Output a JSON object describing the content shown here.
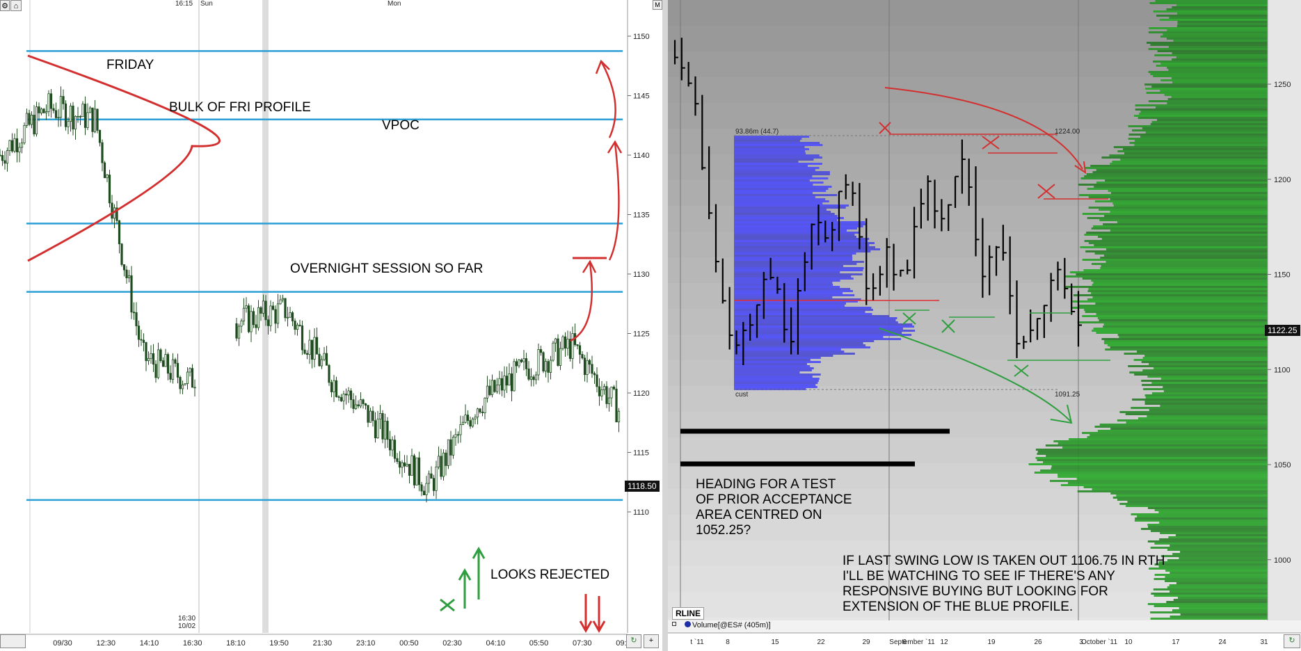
{
  "left_chart": {
    "session_labels": [
      "16:15",
      "Sun",
      "Mon"
    ],
    "session_break_label": [
      "16:30",
      "10/02"
    ],
    "price_ticks": [
      "1150",
      "1145",
      "1140",
      "1135",
      "1130",
      "1125",
      "1120",
      "1115",
      "1110"
    ],
    "time_ticks": [
      "09/30",
      "12:30",
      "14:10",
      "16:30",
      "18:10",
      "19:50",
      "21:30",
      "23:10",
      "00:50",
      "02:30",
      "04:10",
      "05:50",
      "07:30",
      "09:10"
    ],
    "last_price": "1118.50",
    "levels": [
      1148.75,
      1143.0,
      1134.25,
      1128.5,
      1111.0
    ],
    "annotations": {
      "friday": "FRIDAY",
      "bulk": "BULK OF FRI PROFILE",
      "vpoc": "VPOC",
      "overnight": "OVERNIGHT SESSION SO FAR",
      "rejected": "LOOKS REJECTED"
    }
  },
  "right_chart": {
    "price_ticks": [
      "1250",
      "1200",
      "1150",
      "1100",
      "1050",
      "1000"
    ],
    "date_ticks": [
      "t `11",
      "8",
      "15",
      "22",
      "29",
      "September `11",
      "6",
      "12",
      "19",
      "26",
      "October `11",
      "3",
      "10",
      "17",
      "24",
      "31"
    ],
    "last_price": "1122.25",
    "profile_labels": {
      "top_left": "93.86m (44.7)",
      "top_right": "1224.00",
      "bottom_left": "cust",
      "bottom_right": "1091.25"
    },
    "rline_label": "RLINE",
    "volume_label": "Volume[@ES# (405m)]",
    "notes": {
      "heading": "HEADING FOR A TEST\nOF PRIOR ACCEPTANCE\nAREA CENTRED ON\n1052.25?",
      "swing": "IF LAST SWING LOW IS TAKEN OUT 1106.75 IN RTH\nI'LL BE WATCHING TO SEE IF THERE'S ANY\nRESPONSIVE BUYING BUT LOOKING FOR\nEXTENSION OF THE BLUE PROFILE."
    }
  },
  "colors": {
    "level_line": "#2a9fd6",
    "bull_candle": "#2e7d32",
    "annotation_red": "#d32f2f",
    "annotation_green": "#2e9e3f",
    "profile_blue": "#5a5af0",
    "profile_green": "#2a9a2a"
  },
  "chart_data": [
    {
      "type": "candlestick",
      "title": "",
      "ylim": [
        1108,
        1153
      ],
      "x": [
        "09/30",
        "12:30",
        "14:10",
        "16:30",
        "18:10",
        "19:50",
        "21:30",
        "23:10",
        "00:50",
        "02:30",
        "04:10",
        "05:50",
        "07:30",
        "09:10"
      ],
      "series": [
        {
          "values": [
            1140,
            1144,
            1143,
            1123,
            1121,
            1126,
            1127,
            1121,
            1117,
            1112,
            1119,
            1122,
            1124,
            1118.5
          ]
        }
      ],
      "horizontal_levels": [
        1148.75,
        1143.0,
        1134.25,
        1128.5,
        1111.0
      ]
    },
    {
      "type": "bar",
      "title": "",
      "ylim": [
        975,
        1275
      ],
      "x": [
        "8",
        "15",
        "22",
        "29",
        "6",
        "12",
        "19",
        "26",
        "3"
      ],
      "series": [
        {
          "values": [
            1115,
            1160,
            1150,
            1190,
            1170,
            1210,
            1150,
            1180,
            1122.25
          ]
        }
      ],
      "profile_range": [
        1091.25,
        1224.0
      ]
    }
  ]
}
